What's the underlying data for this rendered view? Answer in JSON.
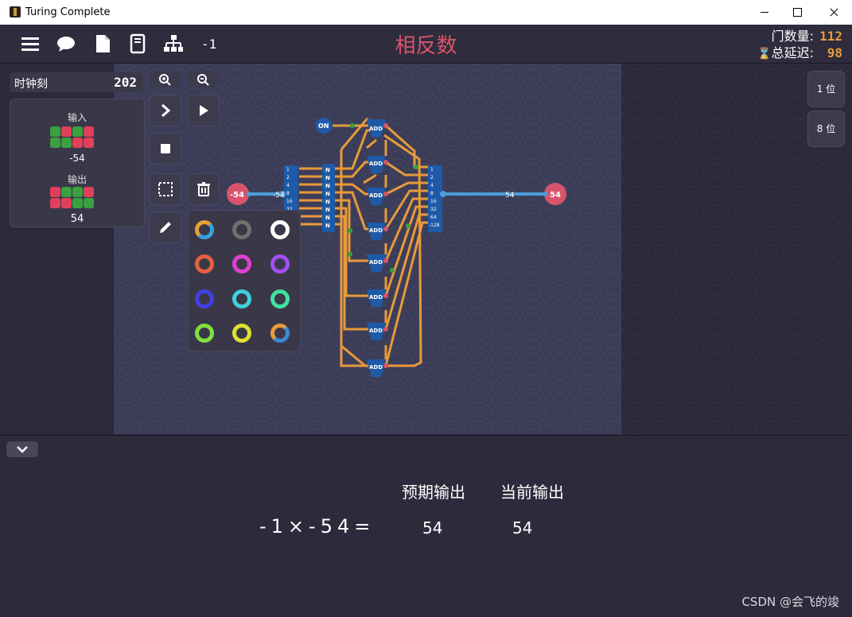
{
  "window": {
    "title": "Turing Complete"
  },
  "toolbar": {
    "counter": "-1",
    "level_title": "相反数"
  },
  "stats": {
    "gates_label": "门数量:",
    "gates_value": "112",
    "delay_label": "总延迟:",
    "delay_value": "98"
  },
  "clock": {
    "label": "时钟刻",
    "value": "202"
  },
  "io_card": {
    "input_label": "输入",
    "input_value": "-54",
    "output_label": "输出",
    "output_value": "54"
  },
  "canvas": {
    "input_pin_value": "-54",
    "output_pin_value": "54",
    "wire_value_left": "-54",
    "wire_value_right": "54",
    "on_label": "ON",
    "add_label": "ADD",
    "not_label": "N",
    "splitter_labels": [
      "1",
      "2",
      "4",
      "8",
      "16",
      "32",
      "64",
      "-128"
    ],
    "bus_wire_color": "#4a9ed8",
    "wire_color": "#e89a3a"
  },
  "bit_sizes": [
    "1 位",
    "8 位"
  ],
  "palette_colors": [
    "#e8a030/#3aa0e0",
    "#707070",
    "#ffffff",
    "#e86040",
    "#e040d0",
    "#a050f0",
    "#4040e0",
    "#40d0e0",
    "#40e0a0",
    "#80e040",
    "#e0e030",
    "#e89a3a/#3a8ad8"
  ],
  "test_table": {
    "expected_header": "预期输出",
    "current_header": "当前输出",
    "equation": "-1×-54=",
    "expected_value": "54",
    "current_value": "54"
  },
  "watermark": "CSDN @会飞的竣"
}
